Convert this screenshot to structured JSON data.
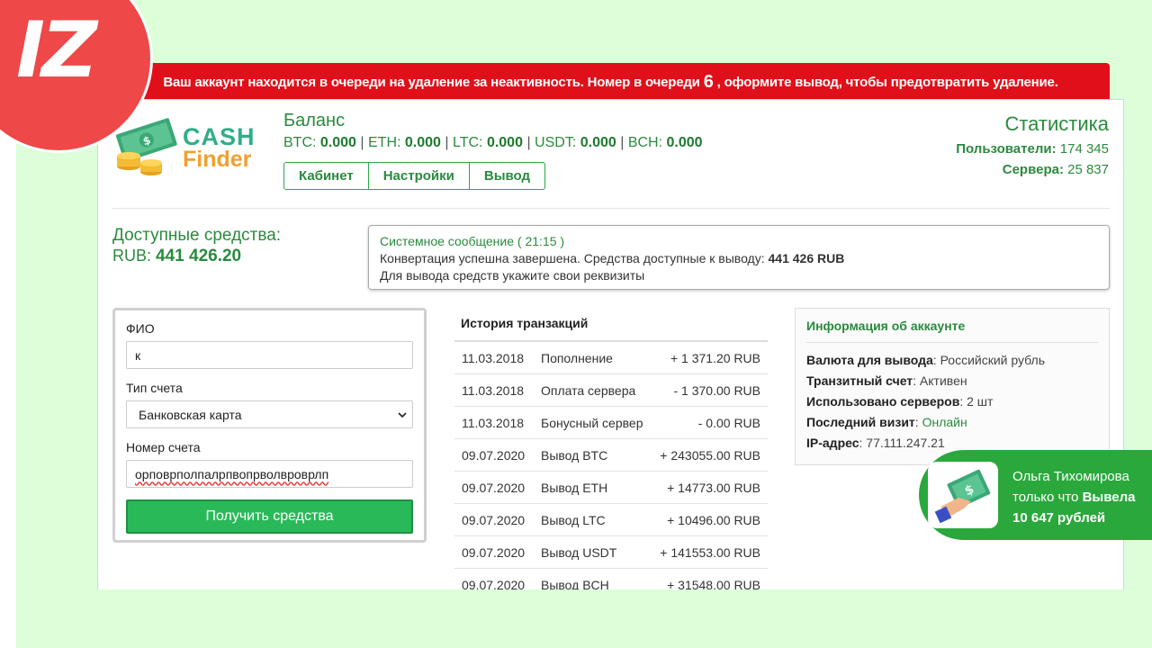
{
  "brand": {
    "iz": "IZ",
    "word1": "CASH",
    "word2": "Finder"
  },
  "alert": {
    "before": "Ваш аккаунт находится в очереди на удаление за неактивность. Номер в очереди",
    "number": "6",
    "after": ", оформите вывод, чтобы предотвратить удаление."
  },
  "balance": {
    "title": "Баланс",
    "btc_label": "BTC: ",
    "btc": "0.000",
    "eth_label": "ETH: ",
    "eth": "0.000",
    "ltc_label": "LTC: ",
    "ltc": "0.000",
    "usdt_label": "USDT: ",
    "usdt": "0.000",
    "bch_label": "BCH: ",
    "bch": "0.000"
  },
  "nav": {
    "cabinet": "Кабинет",
    "settings": "Настройки",
    "withdraw": "Вывод"
  },
  "stats": {
    "title": "Статистика",
    "users_label": "Пользователи:",
    "users": "174 345",
    "servers_label": "Сервера:",
    "servers": "25 837"
  },
  "funds": {
    "label": "Доступные средства:",
    "currency": "RUB:",
    "value": "441 426.20"
  },
  "sysmsg": {
    "title": "Системное сообщение",
    "time": "( 21:15 )",
    "line1": "Конвертация успешна завершена. Средства доступные к выводу:",
    "amount": "441 426 RUB",
    "line2": "Для вывода средств укажите свои реквизиты"
  },
  "form": {
    "name_label": "ФИО",
    "name_value": "к",
    "type_label": "Тип счета",
    "type_value": "Банковская карта",
    "account_label": "Номер счета",
    "account_value": "орповрполпалрпвопрволвроврлп",
    "submit": "Получить средства"
  },
  "transactions": {
    "title": "История транзакций",
    "rows": [
      {
        "date": "11.03.2018",
        "type": "Пополнение",
        "amount": "+ 1 371.20 RUB"
      },
      {
        "date": "11.03.2018",
        "type": "Оплата сервера",
        "amount": "- 1 370.00 RUB"
      },
      {
        "date": "11.03.2018",
        "type": "Бонусный сервер",
        "amount": "- 0.00 RUB"
      },
      {
        "date": "09.07.2020",
        "type": "Вывод BTC",
        "amount": "+ 243055.00 RUB"
      },
      {
        "date": "09.07.2020",
        "type": "Вывод ETH",
        "amount": "+ 14773.00 RUB"
      },
      {
        "date": "09.07.2020",
        "type": "Вывод LTC",
        "amount": "+ 10496.00 RUB"
      },
      {
        "date": "09.07.2020",
        "type": "Вывод USDT",
        "amount": "+ 141553.00 RUB"
      },
      {
        "date": "09.07.2020",
        "type": "Вывод BCH",
        "amount": "+ 31548.00 RUB"
      }
    ]
  },
  "account": {
    "title": "Информация об аккаунте",
    "currency_label": "Валюта для вывода",
    "currency": ": Российский рубль",
    "transit_label": "Транзитный счет",
    "transit": ": Активен",
    "servers_label": "Использовано серверов",
    "servers": ": 2 шт",
    "visit_label": "Последний визит",
    "visit_sep": ": ",
    "visit": "Онлайн",
    "ip_label": "IP-адрес",
    "ip": ": 77.111.247.21"
  },
  "notification": {
    "name": "Ольга Тихомирова",
    "line2_prefix": "только что ",
    "line2_action": "Вывела",
    "amount": "10 647 рублей"
  },
  "icons": {
    "select_arrow": "chevron-down-icon",
    "money": "money-icon"
  }
}
